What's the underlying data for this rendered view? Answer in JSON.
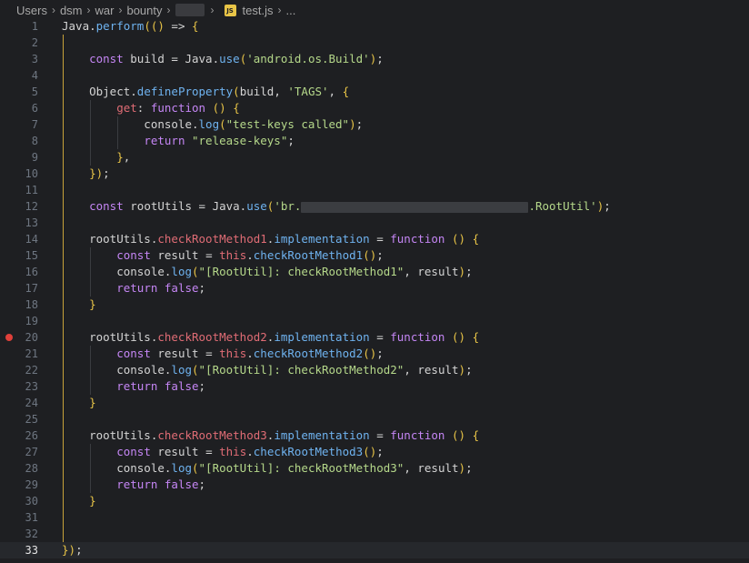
{
  "breadcrumb": {
    "segments": [
      "Users",
      "dsm",
      "war",
      "bounty"
    ],
    "file": "test.js",
    "more": "...",
    "file_icon": "JS"
  },
  "editor": {
    "active_line": 33,
    "breakpoint_line": 20,
    "lines": [
      {
        "n": "1",
        "tokens": [
          [
            "p",
            "Java"
          ],
          [
            "pl",
            "."
          ],
          [
            "fn",
            "perform"
          ],
          [
            "y",
            "(()"
          ],
          [
            "pl",
            " => "
          ],
          [
            "y",
            "{"
          ]
        ]
      },
      {
        "n": "2",
        "tokens": []
      },
      {
        "n": "3",
        "tokens": [
          [
            "pl",
            "    "
          ],
          [
            "kw",
            "const"
          ],
          [
            "pl",
            " build = Java."
          ],
          [
            "fn",
            "use"
          ],
          [
            "y",
            "("
          ],
          [
            "str",
            "'android.os.Build'"
          ],
          [
            "y",
            ")"
          ],
          [
            "pl",
            ";"
          ]
        ]
      },
      {
        "n": "4",
        "tokens": []
      },
      {
        "n": "5",
        "tokens": [
          [
            "pl",
            "    Object."
          ],
          [
            "fn",
            "defineProperty"
          ],
          [
            "y",
            "("
          ],
          [
            "pl",
            "build, "
          ],
          [
            "str",
            "'TAGS'"
          ],
          [
            "pl",
            ", "
          ],
          [
            "y",
            "{"
          ]
        ]
      },
      {
        "n": "6",
        "tokens": [
          [
            "pl",
            "        "
          ],
          [
            "prop",
            "get"
          ],
          [
            "pl",
            ": "
          ],
          [
            "kw",
            "function"
          ],
          [
            "pl",
            " "
          ],
          [
            "y",
            "()"
          ],
          [
            "pl",
            " "
          ],
          [
            "y",
            "{"
          ]
        ]
      },
      {
        "n": "7",
        "tokens": [
          [
            "pl",
            "            console."
          ],
          [
            "fn",
            "log"
          ],
          [
            "y",
            "("
          ],
          [
            "str",
            "\"test-keys called\""
          ],
          [
            "y",
            ")"
          ],
          [
            "pl",
            ";"
          ]
        ]
      },
      {
        "n": "8",
        "tokens": [
          [
            "pl",
            "            "
          ],
          [
            "kw",
            "return"
          ],
          [
            "pl",
            " "
          ],
          [
            "str",
            "\"release-keys\""
          ],
          [
            "pl",
            ";"
          ]
        ]
      },
      {
        "n": "9",
        "tokens": [
          [
            "pl",
            "        "
          ],
          [
            "y",
            "}"
          ],
          [
            "pl",
            ","
          ]
        ]
      },
      {
        "n": "10",
        "tokens": [
          [
            "pl",
            "    "
          ],
          [
            "y",
            "}"
          ],
          [
            "y",
            ")"
          ],
          [
            "pl",
            ";"
          ]
        ]
      },
      {
        "n": "11",
        "tokens": []
      },
      {
        "n": "12",
        "tokens": [
          [
            "pl",
            "    "
          ],
          [
            "kw",
            "const"
          ],
          [
            "pl",
            " rootUtils = Java."
          ],
          [
            "fn",
            "use"
          ],
          [
            "y",
            "("
          ],
          [
            "str",
            "'br."
          ],
          [
            "redact",
            "250"
          ],
          [
            "str",
            ".RootUtil'"
          ],
          [
            "y",
            ")"
          ],
          [
            "pl",
            ";"
          ]
        ]
      },
      {
        "n": "13",
        "tokens": []
      },
      {
        "n": "14",
        "tokens": [
          [
            "pl",
            "    rootUtils."
          ],
          [
            "prop",
            "checkRootMethod1"
          ],
          [
            "pl",
            "."
          ],
          [
            "fn",
            "implementation"
          ],
          [
            "pl",
            " = "
          ],
          [
            "kw",
            "function"
          ],
          [
            "pl",
            " "
          ],
          [
            "y",
            "()"
          ],
          [
            "pl",
            " "
          ],
          [
            "y",
            "{"
          ]
        ]
      },
      {
        "n": "15",
        "tokens": [
          [
            "pl",
            "        "
          ],
          [
            "kw",
            "const"
          ],
          [
            "pl",
            " result = "
          ],
          [
            "this",
            "this"
          ],
          [
            "pl",
            "."
          ],
          [
            "fn",
            "checkRootMethod1"
          ],
          [
            "y",
            "()"
          ],
          [
            "pl",
            ";"
          ]
        ]
      },
      {
        "n": "16",
        "tokens": [
          [
            "pl",
            "        console."
          ],
          [
            "fn",
            "log"
          ],
          [
            "y",
            "("
          ],
          [
            "str",
            "\"[RootUtil]: checkRootMethod1\""
          ],
          [
            "pl",
            ", result"
          ],
          [
            "y",
            ")"
          ],
          [
            "pl",
            ";"
          ]
        ]
      },
      {
        "n": "17",
        "tokens": [
          [
            "pl",
            "        "
          ],
          [
            "kw",
            "return"
          ],
          [
            "pl",
            " "
          ],
          [
            "kw",
            "false"
          ],
          [
            "pl",
            ";"
          ]
        ]
      },
      {
        "n": "18",
        "tokens": [
          [
            "pl",
            "    "
          ],
          [
            "y",
            "}"
          ]
        ]
      },
      {
        "n": "19",
        "tokens": []
      },
      {
        "n": "20",
        "tokens": [
          [
            "pl",
            "    rootUtils."
          ],
          [
            "prop",
            "checkRootMethod2"
          ],
          [
            "pl",
            "."
          ],
          [
            "fn",
            "implementation"
          ],
          [
            "pl",
            " = "
          ],
          [
            "kw",
            "function"
          ],
          [
            "pl",
            " "
          ],
          [
            "y",
            "()"
          ],
          [
            "pl",
            " "
          ],
          [
            "y",
            "{"
          ]
        ]
      },
      {
        "n": "21",
        "tokens": [
          [
            "pl",
            "        "
          ],
          [
            "kw",
            "const"
          ],
          [
            "pl",
            " result = "
          ],
          [
            "this",
            "this"
          ],
          [
            "pl",
            "."
          ],
          [
            "fn",
            "checkRootMethod2"
          ],
          [
            "y",
            "()"
          ],
          [
            "pl",
            ";"
          ]
        ]
      },
      {
        "n": "22",
        "tokens": [
          [
            "pl",
            "        console."
          ],
          [
            "fn",
            "log"
          ],
          [
            "y",
            "("
          ],
          [
            "str",
            "\"[RootUtil]: checkRootMethod2\""
          ],
          [
            "pl",
            ", result"
          ],
          [
            "y",
            ")"
          ],
          [
            "pl",
            ";"
          ]
        ]
      },
      {
        "n": "23",
        "tokens": [
          [
            "pl",
            "        "
          ],
          [
            "kw",
            "return"
          ],
          [
            "pl",
            " "
          ],
          [
            "kw",
            "false"
          ],
          [
            "pl",
            ";"
          ]
        ]
      },
      {
        "n": "24",
        "tokens": [
          [
            "pl",
            "    "
          ],
          [
            "y",
            "}"
          ]
        ]
      },
      {
        "n": "25",
        "tokens": []
      },
      {
        "n": "26",
        "tokens": [
          [
            "pl",
            "    rootUtils."
          ],
          [
            "prop",
            "checkRootMethod3"
          ],
          [
            "pl",
            "."
          ],
          [
            "fn",
            "implementation"
          ],
          [
            "pl",
            " = "
          ],
          [
            "kw",
            "function"
          ],
          [
            "pl",
            " "
          ],
          [
            "y",
            "()"
          ],
          [
            "pl",
            " "
          ],
          [
            "y",
            "{"
          ]
        ]
      },
      {
        "n": "27",
        "tokens": [
          [
            "pl",
            "        "
          ],
          [
            "kw",
            "const"
          ],
          [
            "pl",
            " result = "
          ],
          [
            "this",
            "this"
          ],
          [
            "pl",
            "."
          ],
          [
            "fn",
            "checkRootMethod3"
          ],
          [
            "y",
            "()"
          ],
          [
            "pl",
            ";"
          ]
        ]
      },
      {
        "n": "28",
        "tokens": [
          [
            "pl",
            "        console."
          ],
          [
            "fn",
            "log"
          ],
          [
            "y",
            "("
          ],
          [
            "str",
            "\"[RootUtil]: checkRootMethod3\""
          ],
          [
            "pl",
            ", result"
          ],
          [
            "y",
            ")"
          ],
          [
            "pl",
            ";"
          ]
        ]
      },
      {
        "n": "29",
        "tokens": [
          [
            "pl",
            "        "
          ],
          [
            "kw",
            "return"
          ],
          [
            "pl",
            " "
          ],
          [
            "kw",
            "false"
          ],
          [
            "pl",
            ";"
          ]
        ]
      },
      {
        "n": "30",
        "tokens": [
          [
            "pl",
            "    "
          ],
          [
            "y",
            "}"
          ]
        ]
      },
      {
        "n": "31",
        "tokens": []
      },
      {
        "n": "32",
        "tokens": []
      },
      {
        "n": "33",
        "tokens": [
          [
            "y",
            "})"
          ],
          [
            "pl",
            ";"
          ]
        ]
      }
    ]
  },
  "colors": {
    "background": "#1e1f22",
    "keyword": "#c586f5",
    "function": "#6fb3f0",
    "property": "#e06c75",
    "string": "#b5d88a",
    "bracket": "#e8c447",
    "breakpoint": "#e0403a"
  }
}
